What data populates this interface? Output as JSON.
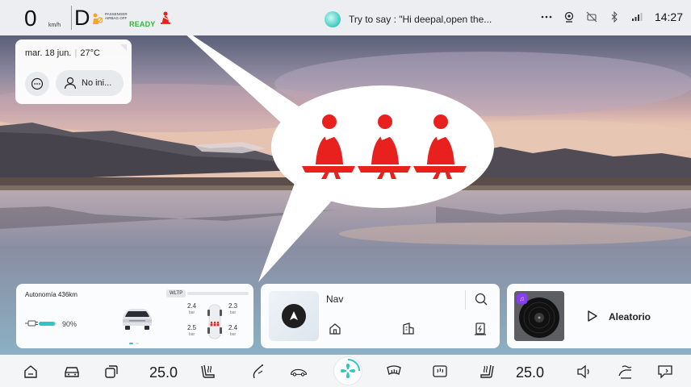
{
  "status_bar": {
    "speed": "0",
    "speed_unit": "km/h",
    "gear": "D",
    "airbag_text": "PASSENGER AIRBAG OFF",
    "ready": "READY",
    "voice_prompt": "Try to say : \"Hi deepal,open the...",
    "icons": [
      "more-icon",
      "camera-icon",
      "sync-off-icon",
      "bluetooth-icon",
      "signal-icon"
    ],
    "time": "14:27"
  },
  "date_widget": {
    "date": "mar. 18 jun.",
    "temperature": "27°C",
    "profile_label": "No ini..."
  },
  "range_card": {
    "title": "Autonomía 436km",
    "badge": "WLTP",
    "battery_percent": "90%",
    "battery_fraction": 0.9,
    "tires": [
      {
        "value": "2.4",
        "unit": "bar"
      },
      {
        "value": "2.3",
        "unit": "bar"
      },
      {
        "value": "2.5",
        "unit": "bar"
      },
      {
        "value": "2.4",
        "unit": "bar"
      }
    ]
  },
  "nav_card": {
    "label": "Nav"
  },
  "media_card": {
    "title": "Aleatorio"
  },
  "dock": {
    "temp_left": "25.0",
    "temp_right": "25.0"
  },
  "colors": {
    "seatbelt_red": "#e8201e",
    "ready_green": "#2fb835",
    "accent_teal": "#2ec6c4",
    "music_purple": "#8a3cf0"
  }
}
